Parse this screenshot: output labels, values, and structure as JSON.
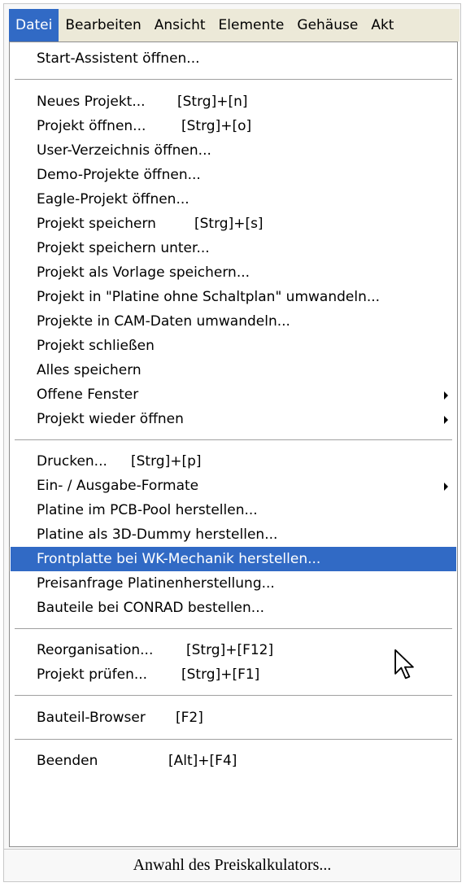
{
  "menubar": {
    "items": [
      {
        "label": "Datei"
      },
      {
        "label": "Bearbeiten"
      },
      {
        "label": "Ansicht"
      },
      {
        "label": "Elemente"
      },
      {
        "label": "Gehäuse"
      },
      {
        "label": "Akt"
      }
    ],
    "active": "Datei"
  },
  "menu": {
    "start_assistant": "Start-Assistent öffnen...",
    "new_project": "Neues Projekt...",
    "new_project_shortcut": "[Strg]+[n]",
    "open_project": "Projekt öffnen...",
    "open_project_shortcut": "[Strg]+[o]",
    "open_user_dir": "User-Verzeichnis öffnen...",
    "open_demo": "Demo-Projekte öffnen...",
    "open_eagle": "Eagle-Projekt öffnen...",
    "save_project": "Projekt speichern",
    "save_project_shortcut": "[Strg]+[s]",
    "save_project_as": "Projekt speichern unter...",
    "save_as_template": "Projekt als Vorlage speichern...",
    "convert_no_schematic": "Projekt in \"Platine ohne Schaltplan\" umwandeln...",
    "convert_cam": "Projekte in CAM-Daten umwandeln...",
    "close_project": "Projekt schließen",
    "save_all": "Alles speichern",
    "open_windows": "Offene Fenster",
    "reopen_project": "Projekt wieder öffnen",
    "print": "Drucken...",
    "print_shortcut": "[Strg]+[p]",
    "io_formats": "Ein- / Ausgabe-Formate",
    "pcb_pool": "Platine im PCB-Pool herstellen...",
    "pcb_3d_dummy": "Platine als 3D-Dummy herstellen...",
    "front_panel_wk": "Frontplatte bei WK-Mechanik herstellen...",
    "price_inquiry": "Preisanfrage Platinenherstellung...",
    "order_conrad": "Bauteile bei CONRAD bestellen...",
    "reorganisation": "Reorganisation...",
    "reorganisation_shortcut": "[Strg]+[F12]",
    "check_project": "Projekt prüfen...",
    "check_project_shortcut": "[Strg]+[F1]",
    "part_browser": "Bauteil-Browser",
    "part_browser_shortcut": "[F2]",
    "quit": "Beenden",
    "quit_shortcut": "[Alt]+[F4]"
  },
  "caption": "Anwahl des Preiskalkulators...",
  "colors": {
    "menubar_bg": "#ece9d8",
    "highlight": "#316ac5",
    "highlight_text": "#ffffff"
  },
  "icons": {
    "submenu": "submenu-arrow-icon",
    "cursor": "mouse-pointer-icon"
  }
}
